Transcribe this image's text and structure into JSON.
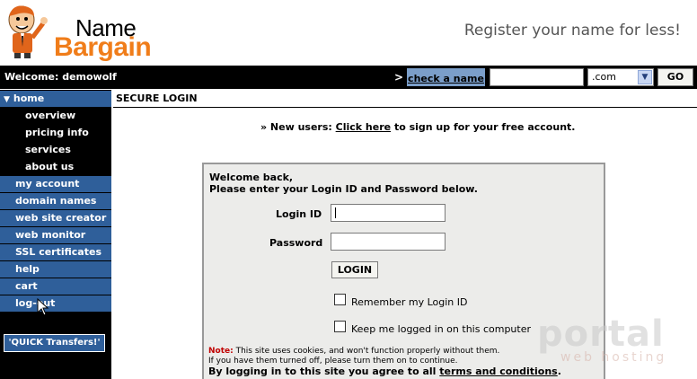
{
  "header": {
    "logo_name": "Name",
    "logo_bargain": "Bargain",
    "tagline": "Register your name for less!"
  },
  "topbar": {
    "welcome": "Welcome: demowolf",
    "arrow": ">",
    "check_link": "check a name",
    "domain_value": "",
    "tld_selected": ".com",
    "go_label": "GO"
  },
  "sidebar": {
    "home": "home",
    "subitems": [
      "overview",
      "pricing info",
      "services",
      "about us"
    ],
    "items": [
      "my account",
      "domain names",
      "web site creator",
      "web monitor",
      "SSL certificates",
      "help",
      "cart",
      "log-out"
    ],
    "quick_transfers": "'QUICK Transfers!'"
  },
  "content": {
    "heading": "SECURE LOGIN",
    "new_users_prefix": "» New users: ",
    "new_users_link": "Click here",
    "new_users_suffix": " to sign up for your free account."
  },
  "login": {
    "welcome_line1": "Welcome back,",
    "welcome_line2": "Please enter your Login ID and Password below.",
    "login_id_label": "Login ID",
    "login_id_value": "",
    "password_label": "Password",
    "password_value": "",
    "login_button": "LOGIN",
    "remember_label": "Remember my Login ID",
    "keep_label": "Keep me logged in on this computer",
    "note_label": "Note:",
    "note_text": " This site uses cookies, and won't function properly without them.",
    "note_text2": "If you have them turned off, please turn them on to continue.",
    "agree_prefix": "By logging in to this site you agree to all ",
    "agree_link": "terms and conditions",
    "agree_suffix": "."
  },
  "watermark": {
    "portal": "portal",
    "hosting": "web hosting"
  },
  "colors": {
    "nav_blue": "#2f5f9a",
    "check_bg": "#7b9ec9",
    "brand_orange": "#f07d1a",
    "note_red": "#c00000"
  }
}
